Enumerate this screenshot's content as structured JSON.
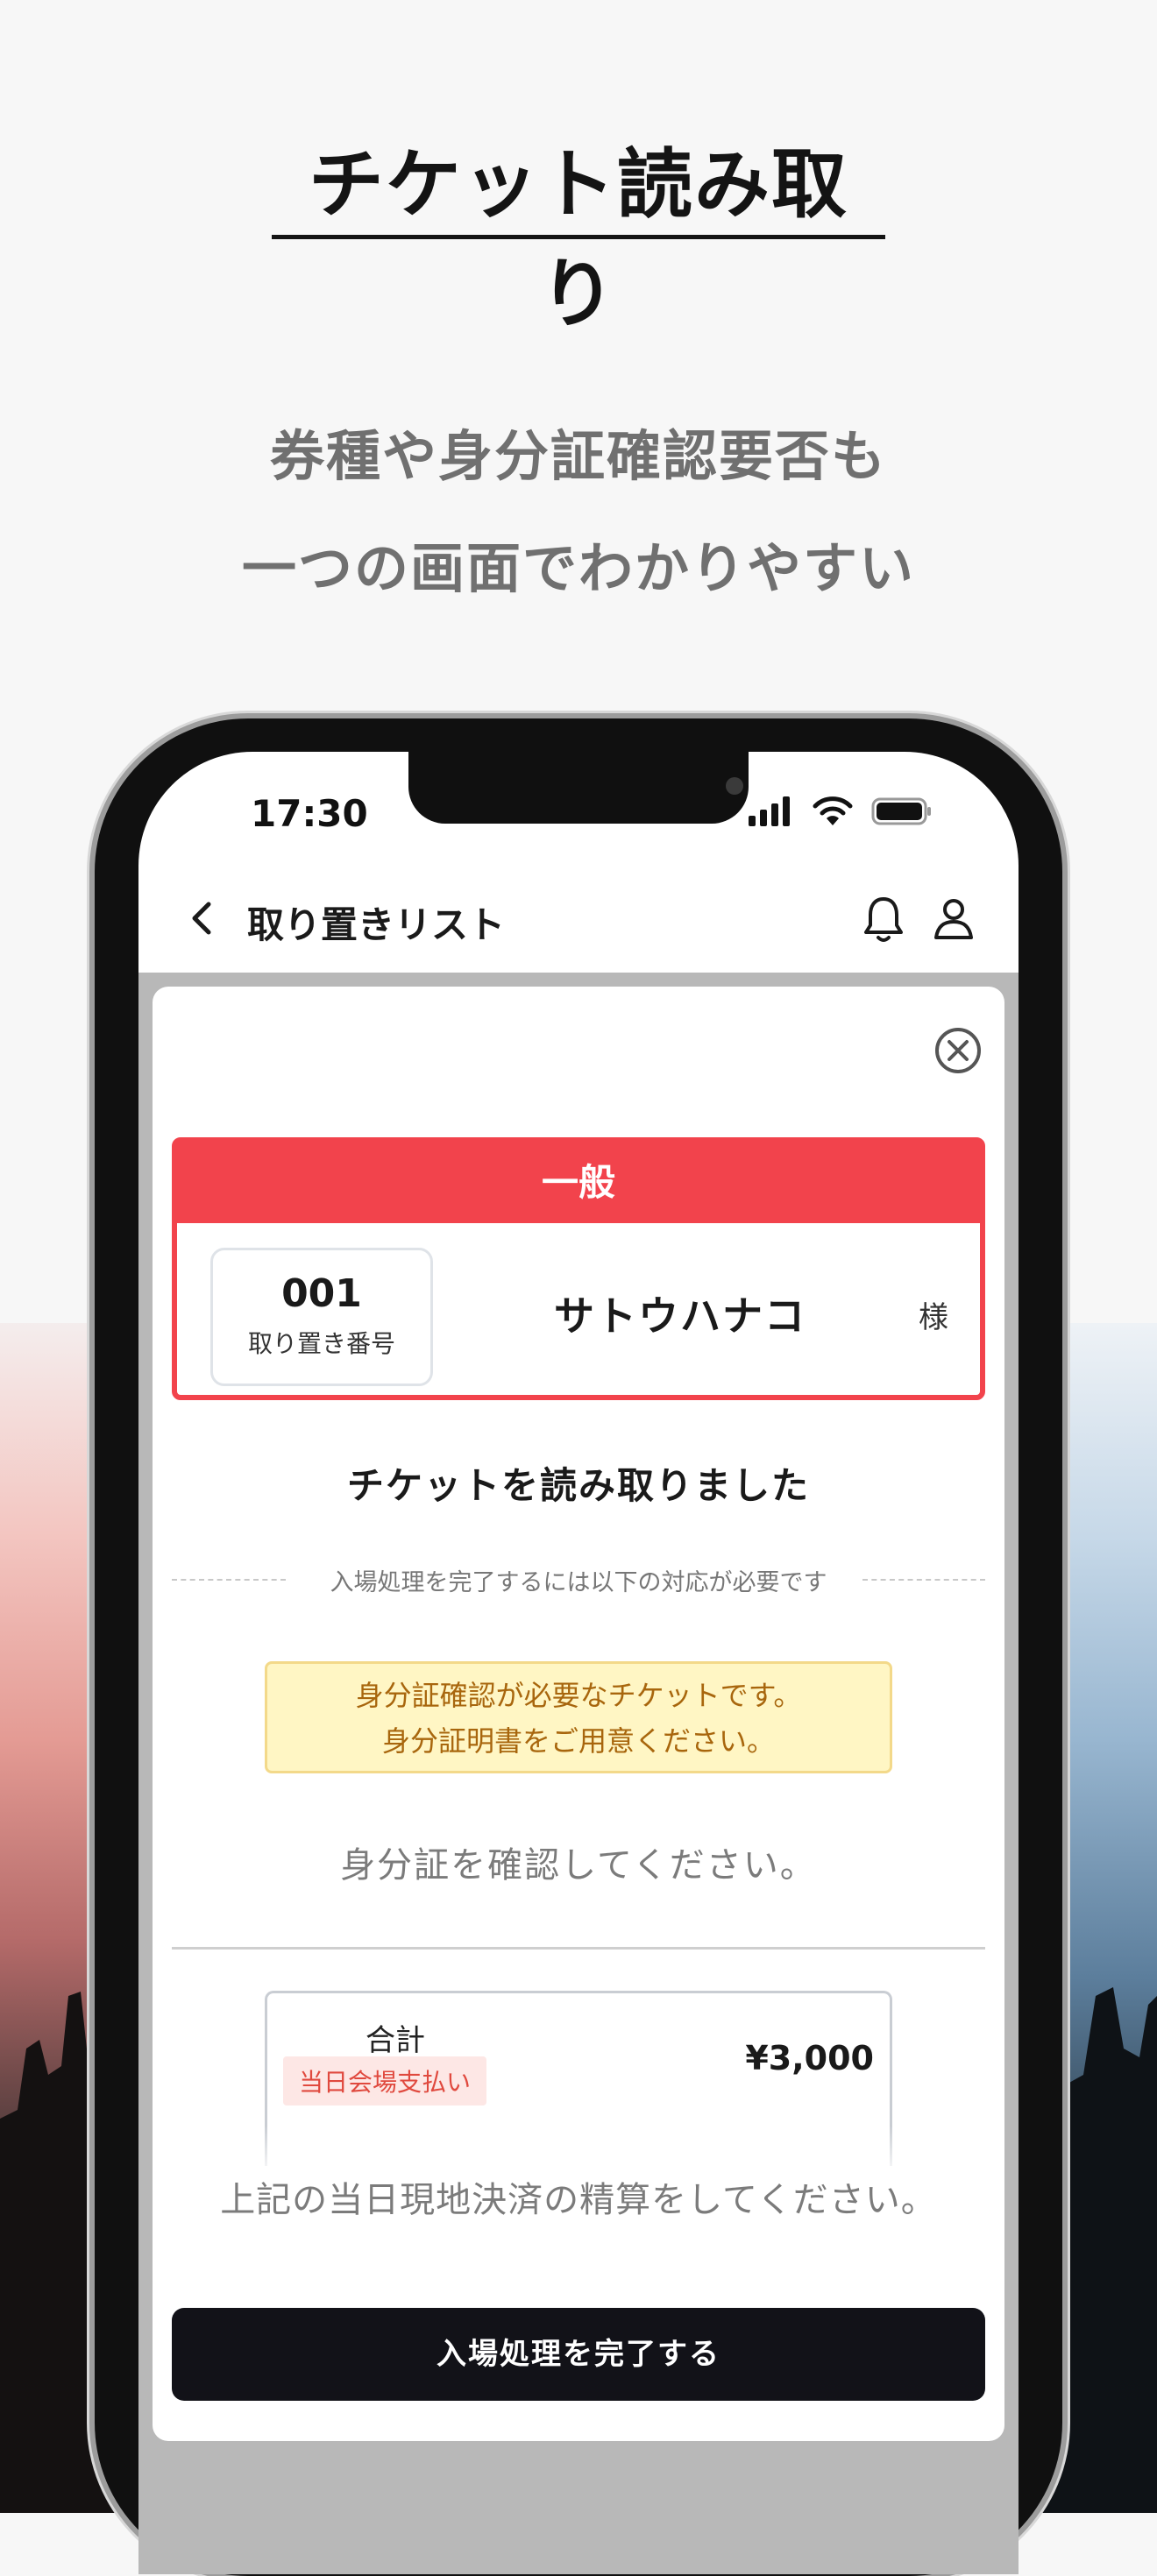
{
  "promo": {
    "title": "チケット読み取り",
    "subtitle_line1": "券種や身分証確認要否も",
    "subtitle_line2": "一つの画面でわかりやすい"
  },
  "status_bar": {
    "time": "17:30",
    "icons": [
      "signal-icon",
      "wifi-icon",
      "battery-icon"
    ]
  },
  "header": {
    "title": "取り置きリスト",
    "icons": [
      "back-icon",
      "bell-icon",
      "user-icon"
    ]
  },
  "ticket": {
    "type": "一般",
    "reserve_number": "001",
    "reserve_label": "取り置き番号",
    "customer_name": "サトウハナコ",
    "honorific": "様"
  },
  "result": {
    "message": "チケットを読み取りました",
    "requirement_note": "入場処理を完了するには以下の対応が必要です",
    "warning_line1": "身分証確認が必要なチケットです。",
    "warning_line2": "身分証明書をご用意ください。",
    "id_check": "身分証を確認してください。"
  },
  "payment": {
    "label": "合計",
    "badge": "当日会場支払い",
    "amount": "¥3,000",
    "settle_instruction": "上記の当日現地決済の精算をしてください。"
  },
  "actions": {
    "complete_button": "入場処理を完了する"
  },
  "colors": {
    "accent_red": "#f2434c",
    "warning_bg": "#fff6c4",
    "warning_text": "#a8660d",
    "button_dark": "#121218"
  }
}
